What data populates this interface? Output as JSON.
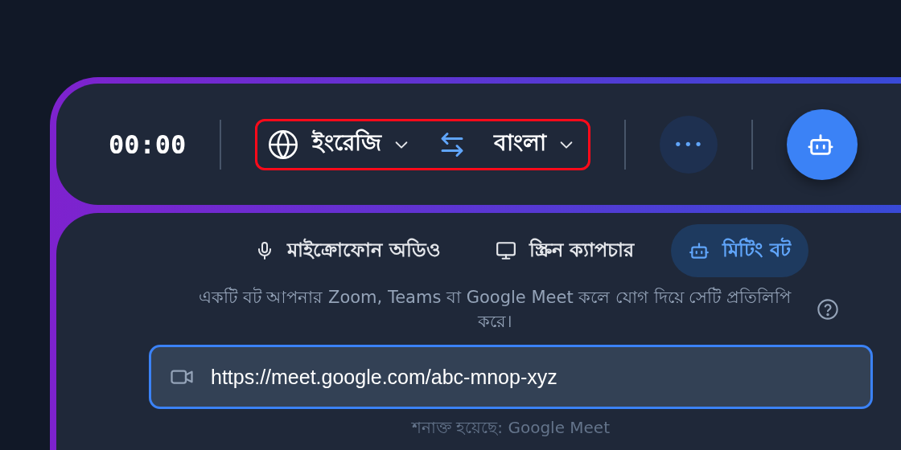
{
  "toolbar": {
    "timer": "00:00",
    "language_selector": {
      "highlighted": true,
      "source": "ইংরেজি",
      "target": "বাংলা"
    },
    "more_button": {
      "label": "•••"
    },
    "bot_button": {
      "selected": true
    }
  },
  "tabs": [
    {
      "label": "মাইক্রোফোন অডিও",
      "kind": "mic",
      "selected": false
    },
    {
      "label": "স্ক্রিন ক্যাপচার",
      "kind": "monitor",
      "selected": false
    },
    {
      "label": "মিটিং বট",
      "kind": "bot",
      "selected": true
    }
  ],
  "description": "একটি বট আপনার Zoom, Teams বা Google Meet কলে যোগ দিয়ে সেটি প্রতিলিপি করে।",
  "meeting_link": {
    "value": "https://meet.google.com/abc-mnop-xyz",
    "focused": true
  },
  "detected": "শনাক্ত হয়েছে: Google Meet"
}
